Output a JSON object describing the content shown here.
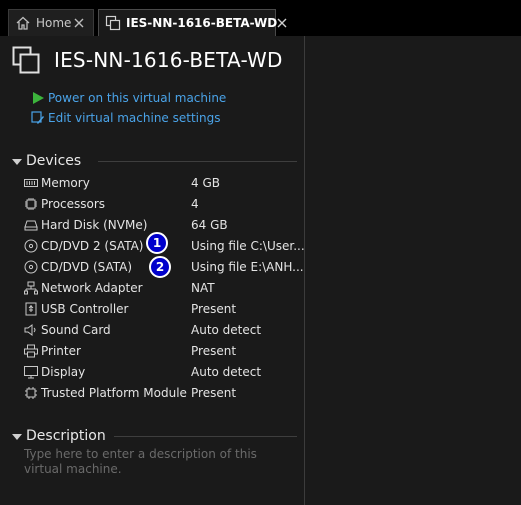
{
  "tabs": [
    {
      "label": "Home",
      "icon": "home-icon",
      "active": false
    },
    {
      "label": "IES-NN-1616-BETA-WD",
      "icon": "vm-tab-icon",
      "active": true
    }
  ],
  "vm": {
    "title": "IES-NN-1616-BETA-WD",
    "icon": "virtual-machine-icon"
  },
  "actions": {
    "power_on": "Power on this virtual machine",
    "edit_settings": "Edit virtual machine settings"
  },
  "devices": {
    "heading": "Devices",
    "items": [
      {
        "name": "Memory",
        "value": "4 GB",
        "icon": "memory-icon"
      },
      {
        "name": "Processors",
        "value": "4",
        "icon": "processor-icon"
      },
      {
        "name": "Hard Disk (NVMe)",
        "value": "64 GB",
        "icon": "hard-disk-icon"
      },
      {
        "name": "CD/DVD 2 (SATA)",
        "value": "Using file C:\\User...",
        "icon": "cd-dvd-icon"
      },
      {
        "name": "CD/DVD (SATA)",
        "value": "Using file E:\\ANH...",
        "icon": "cd-dvd-icon"
      },
      {
        "name": "Network Adapter",
        "value": "NAT",
        "icon": "network-adapter-icon"
      },
      {
        "name": "USB Controller",
        "value": "Present",
        "icon": "usb-icon"
      },
      {
        "name": "Sound Card",
        "value": "Auto detect",
        "icon": "sound-card-icon"
      },
      {
        "name": "Printer",
        "value": "Present",
        "icon": "printer-icon"
      },
      {
        "name": "Display",
        "value": "Auto detect",
        "icon": "display-icon"
      },
      {
        "name": "Trusted Platform Module",
        "value": "Present",
        "icon": "tpm-icon"
      }
    ]
  },
  "annotations": {
    "badge_1": "1",
    "badge_2": "2"
  },
  "description": {
    "heading": "Description",
    "placeholder": "Type here to enter a description of this virtual machine."
  },
  "colors": {
    "link": "#4aa3e8",
    "power_green": "#3cb43c",
    "badge_blue": "#0000cc"
  }
}
